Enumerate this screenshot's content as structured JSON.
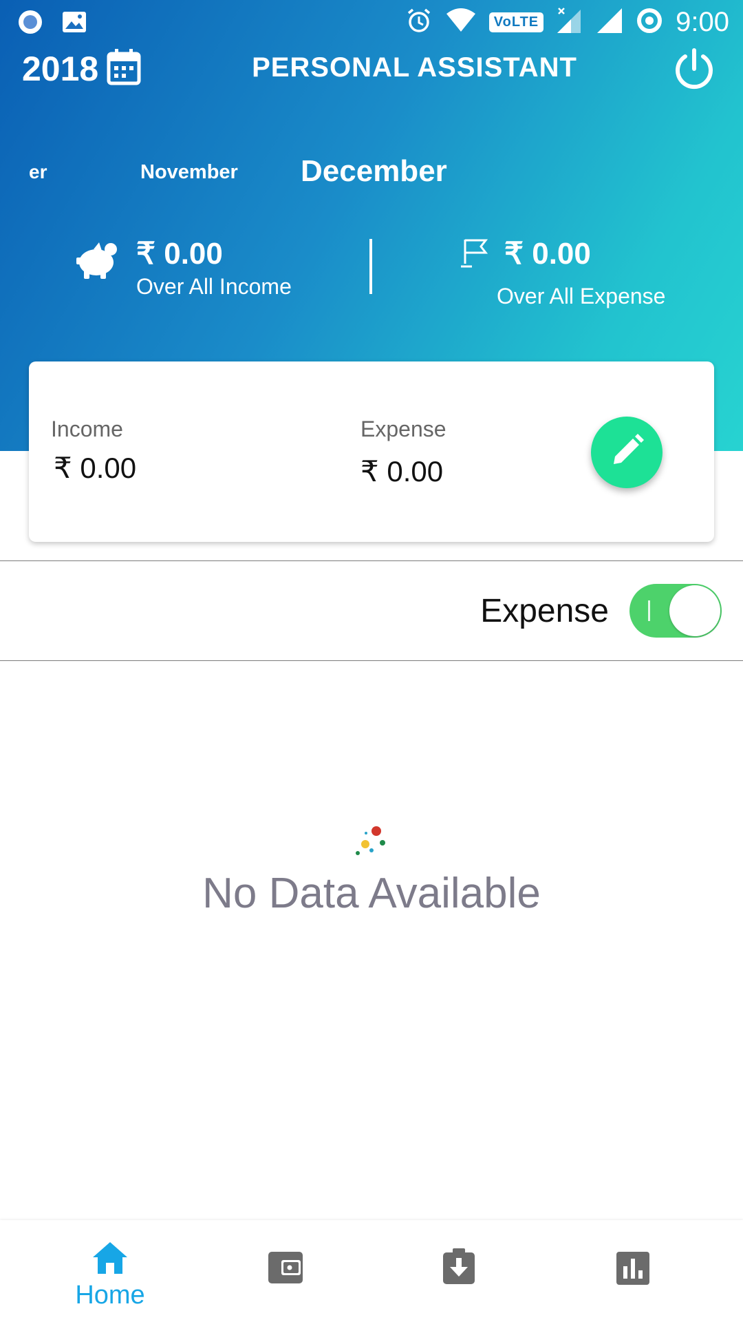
{
  "status_bar": {
    "time": "9:00",
    "volte": "VoLTE",
    "left_icons": [
      "record-icon",
      "image-icon"
    ],
    "right_icons": [
      "alarm-icon",
      "wifi-icon",
      "signal-icon",
      "signal-icon",
      "data-saver-icon"
    ]
  },
  "app_bar": {
    "year": "2018",
    "title": "PERSONAL ASSISTANT",
    "icons": [
      "calendar-icon",
      "power-icon"
    ]
  },
  "months": {
    "previous": "er",
    "before_current": "November",
    "current": "December"
  },
  "overall": {
    "income": {
      "amount": "₹ 0.00",
      "label": "Over All Income",
      "icon": "piggy-bank-icon"
    },
    "expense": {
      "amount": "₹ 0.00",
      "label": "Over All Expense",
      "icon": "flag-icon"
    }
  },
  "card": {
    "income_label": "Income",
    "income_value": "₹ 0.00",
    "expense_label": "Expense",
    "expense_value": "₹ 0.00",
    "edit_icon": "pencil-icon"
  },
  "toggle": {
    "label": "Expense",
    "on": true
  },
  "empty_state": {
    "text": "No Data Available"
  },
  "bottom_nav": {
    "items": [
      {
        "label": "Home",
        "icon": "home-icon",
        "active": true
      },
      {
        "label": "",
        "icon": "wallet-icon",
        "active": false
      },
      {
        "label": "",
        "icon": "download-clipboard-icon",
        "active": false
      },
      {
        "label": "",
        "icon": "bar-chart-icon",
        "active": false
      }
    ]
  },
  "colors": {
    "header_start": "#0a5fb4",
    "header_end": "#27d3d1",
    "fab": "#1de196",
    "toggle_on": "#4dd26b",
    "nav_active": "#17a6e6",
    "nav_inactive": "#6b6b6b",
    "empty_text": "#7d7b8a"
  }
}
